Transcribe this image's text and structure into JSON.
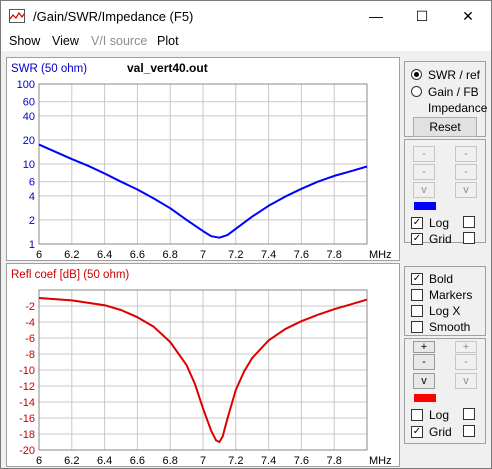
{
  "window": {
    "title": "/Gain/SWR/Impedance (F5)",
    "minimize_glyph": "—",
    "maximize_glyph": "☐",
    "close_glyph": "✕"
  },
  "menu": {
    "items": [
      {
        "label": "Show",
        "enabled": true
      },
      {
        "label": "View",
        "enabled": true
      },
      {
        "label": "V/I source",
        "enabled": false
      },
      {
        "label": "Plot",
        "enabled": true
      }
    ]
  },
  "top_controls": {
    "radio_swr": "SWR / ref",
    "radio_gain": "Gain / FB",
    "radio_impedance": "Impedance",
    "selected": "SWR / ref",
    "reset_button": "Reset",
    "scale_buttons": [
      "-",
      "-",
      "-",
      "-",
      "v",
      "v"
    ],
    "series_color": "#0000ff",
    "log_label": "Log",
    "log_checked": true,
    "grid_label": "Grid",
    "grid_checked": true,
    "second_checks": [
      false,
      false
    ]
  },
  "bottom_controls": {
    "bold_label": "Bold",
    "bold_checked": true,
    "markers_label": "Markers",
    "markers_checked": false,
    "logx_label": "Log X",
    "logx_checked": false,
    "smooth_label": "Smooth",
    "smooth_checked": false,
    "scale_buttons": [
      "+",
      "+",
      "-",
      "-",
      "v",
      "v"
    ],
    "series_color": "#ff0000",
    "log_label": "Log",
    "log_checked": false,
    "grid_label": "Grid",
    "grid_checked": true,
    "second_checks": [
      false,
      false
    ]
  },
  "chart_data": [
    {
      "type": "line",
      "title": "val_vert40.out",
      "ylabel": "SWR (50 ohm)",
      "xlabel": "MHz",
      "y_scale": "log",
      "xlim": [
        6,
        8
      ],
      "ylim": [
        1,
        100
      ],
      "x_ticks": [
        "6",
        "6.2",
        "6.4",
        "6.6",
        "6.8",
        "7",
        "7.2",
        "7.4",
        "7.6",
        "7.8"
      ],
      "y_ticks": [
        "1",
        "2",
        "4",
        "6",
        "10",
        "20",
        "40",
        "60",
        "100"
      ],
      "grid": true,
      "series": [
        {
          "color": "#0000ff",
          "x": [
            6.0,
            6.1,
            6.2,
            6.3,
            6.4,
            6.5,
            6.6,
            6.7,
            6.8,
            6.9,
            7.0,
            7.05,
            7.1,
            7.15,
            7.2,
            7.3,
            7.4,
            7.5,
            7.6,
            7.7,
            7.8,
            7.9,
            8.0
          ],
          "y": [
            17.5,
            14.2,
            11.5,
            9.5,
            7.6,
            6.0,
            4.8,
            3.7,
            2.8,
            2.0,
            1.45,
            1.25,
            1.2,
            1.3,
            1.55,
            2.2,
            3.0,
            3.9,
            4.9,
            6.0,
            7.1,
            8.1,
            9.3
          ]
        }
      ]
    },
    {
      "type": "line",
      "ylabel": "Refl coef [dB] (50 ohm)",
      "xlabel": "MHz",
      "xlim": [
        6,
        8
      ],
      "ylim": [
        -20,
        0
      ],
      "x_ticks": [
        "6",
        "6.2",
        "6.4",
        "6.6",
        "6.8",
        "7",
        "7.2",
        "7.4",
        "7.6",
        "7.8"
      ],
      "y_ticks": [
        "-2",
        "-4",
        "-6",
        "-8",
        "-10",
        "-12",
        "-14",
        "-16",
        "-18",
        "-20"
      ],
      "grid": true,
      "series": [
        {
          "color": "#dd0000",
          "x": [
            6.0,
            6.2,
            6.4,
            6.5,
            6.6,
            6.7,
            6.8,
            6.9,
            6.95,
            7.0,
            7.05,
            7.08,
            7.1,
            7.12,
            7.15,
            7.2,
            7.25,
            7.3,
            7.4,
            7.5,
            7.6,
            7.7,
            7.8,
            7.9,
            8.0
          ],
          "y": [
            -1.0,
            -1.3,
            -1.9,
            -2.5,
            -3.4,
            -4.6,
            -6.5,
            -9.4,
            -11.7,
            -14.8,
            -17.6,
            -18.8,
            -19.0,
            -18.3,
            -16.0,
            -12.5,
            -10.2,
            -8.5,
            -6.3,
            -4.9,
            -3.9,
            -3.1,
            -2.4,
            -1.8,
            -1.2
          ]
        }
      ]
    }
  ]
}
